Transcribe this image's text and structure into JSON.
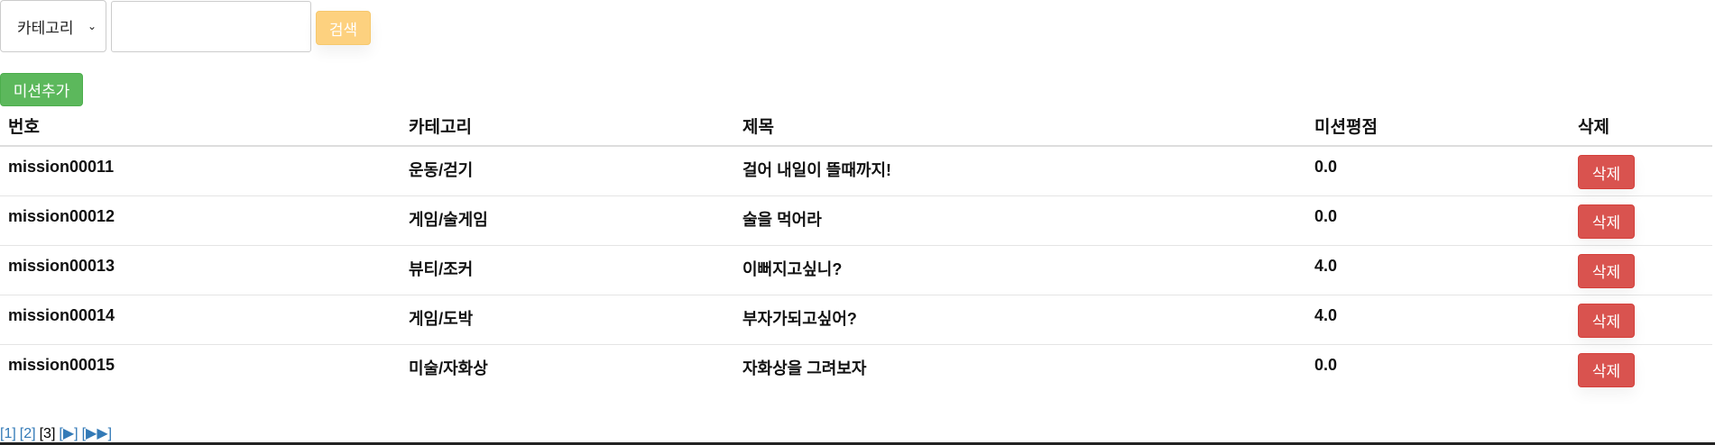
{
  "search": {
    "category_label": "카테고리",
    "input_value": "",
    "input_placeholder": "",
    "search_label": "검색"
  },
  "toolbar": {
    "add_label": "미션추가"
  },
  "table": {
    "headers": [
      "번호",
      "카테고리",
      "제목",
      "미션평점",
      "삭제"
    ],
    "rows": [
      {
        "id": "mission00011",
        "category": "운동/걷기",
        "title": "걸어 내일이 뜰때까지!",
        "rating": "0.0",
        "delete_label": "삭제"
      },
      {
        "id": "mission00012",
        "category": "게임/술게임",
        "title": "술을 먹어라",
        "rating": "0.0",
        "delete_label": "삭제"
      },
      {
        "id": "mission00013",
        "category": "뷰티/조커",
        "title": "이뻐지고싶니?",
        "rating": "4.0",
        "delete_label": "삭제"
      },
      {
        "id": "mission00014",
        "category": "게임/도박",
        "title": "부자가되고싶어?",
        "rating": "4.0",
        "delete_label": "삭제"
      },
      {
        "id": "mission00015",
        "category": "미술/자화상",
        "title": "자화상을 그려보자",
        "rating": "0.0",
        "delete_label": "삭제"
      }
    ]
  },
  "pagination": {
    "page1": "[1]",
    "page2": "[2]",
    "current": "[3]",
    "next": "[▶]",
    "last": "[▶▶]"
  },
  "colors": {
    "search_button": "#fdd17f",
    "add_button": "#5cb85c",
    "delete_button": "#d9534f",
    "link": "#337ab7"
  }
}
